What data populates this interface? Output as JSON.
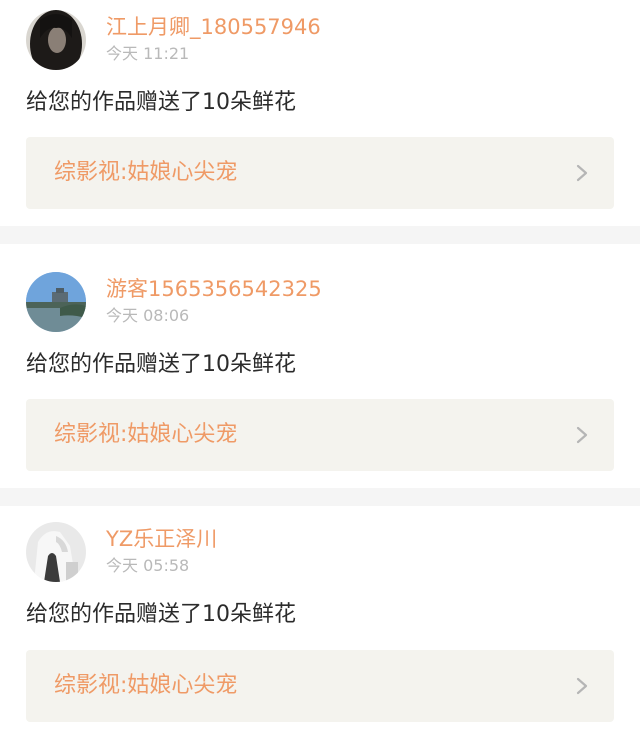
{
  "notifications": [
    {
      "avatar": "dark-hair-portrait",
      "username": "江上月卿_180557946",
      "time": "今天 11:21",
      "message": "给您的作品赠送了10朵鲜花",
      "work_title": "综影视:姑娘心尖宠"
    },
    {
      "avatar": "lake-landscape",
      "username": "游客1565356542325",
      "time": "今天 08:06",
      "message": "给您的作品赠送了10朵鲜花",
      "work_title": "综影视:姑娘心尖宠"
    },
    {
      "avatar": "person-white-shirt",
      "username": "YZ乐正泽川",
      "time": "今天 05:58",
      "message": "给您的作品赠送了10朵鲜花",
      "work_title": "综影视:姑娘心尖宠"
    }
  ],
  "icons": {
    "chevron": "chevron-right-icon"
  },
  "colors": {
    "accent": "#ef9a66",
    "time": "#b9b9b9",
    "text": "#2b2b2b",
    "link_bg": "#f4f3ee",
    "divider": "#f5f5f5"
  }
}
